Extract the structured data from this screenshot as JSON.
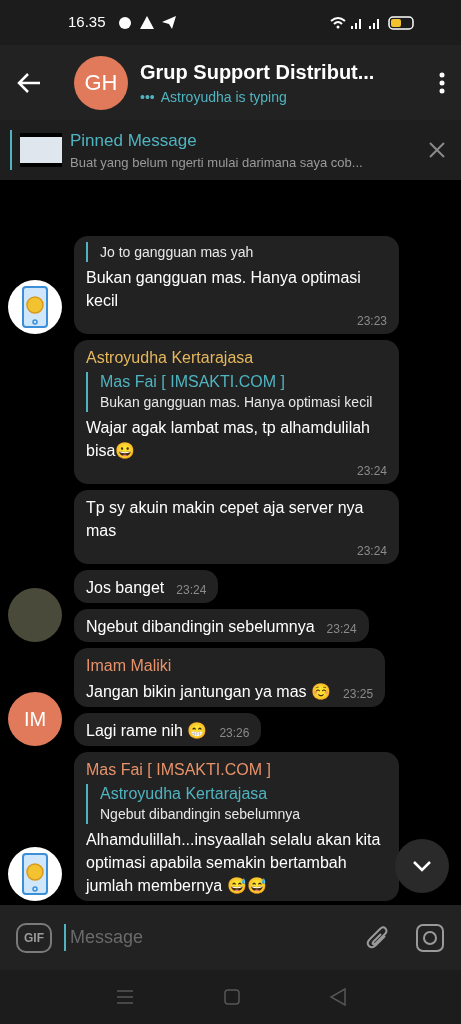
{
  "status_bar": {
    "time": "16.35"
  },
  "header": {
    "avatar_initials": "GH",
    "title": "Grup Support Distribut...",
    "subtitle_dots": "•••",
    "subtitle": "Astroyudha is typing"
  },
  "pinned": {
    "title": "Pinned Message",
    "text": "Buat yang belum ngerti mulai darimana saya cob..."
  },
  "groups": [
    {
      "avatar": {
        "kind": "logo"
      },
      "messages": [
        {
          "quote": {
            "text": "Jo to gangguan mas yah"
          },
          "text": "Bukan gangguan mas. Hanya optimasi kecil",
          "time": "23:23"
        }
      ]
    },
    {
      "avatar": {
        "kind": "photo"
      },
      "messages": [
        {
          "sender": {
            "name": "Astroyudha Kertarajasa",
            "color": "#e6b85c"
          },
          "quote": {
            "name": "Mas Fai [ IMSAKTI.COM ]",
            "text": "Bukan gangguan mas. Hanya optimasi kecil"
          },
          "text": "Wajar agak lambat mas, tp alhamdulilah bisa😀",
          "time": "23:24"
        },
        {
          "text": "Tp sy akuin makin cepet aja server nya mas",
          "time": "23:24"
        },
        {
          "text": "Jos banget",
          "time": "23:24"
        },
        {
          "text": "Ngebut dibandingin sebelumnya",
          "time": "23:24"
        }
      ]
    },
    {
      "avatar": {
        "kind": "initials",
        "initials": "IM"
      },
      "messages": [
        {
          "sender": {
            "name": "Imam Maliki",
            "color": "#e8926a"
          },
          "text": "Jangan bikin jantungan ya mas ☺️",
          "time": "23:25"
        },
        {
          "text": "Lagi rame nih 😁",
          "time": "23:26"
        }
      ]
    },
    {
      "avatar": {
        "kind": "logo"
      },
      "messages": [
        {
          "sender": {
            "name": "Mas Fai [ IMSAKTI.COM ]",
            "color": "#e8926a"
          },
          "quote": {
            "name": "Astroyudha Kertarajasa",
            "text": "Ngebut dibandingin sebelumnya"
          },
          "text": "Alhamdulillah...insyaallah selalu akan kita optimasi apabila semakin bertambah jumlah membernya 😅😅"
        }
      ]
    }
  ],
  "composer": {
    "gif_label": "GIF",
    "placeholder": "Message"
  }
}
